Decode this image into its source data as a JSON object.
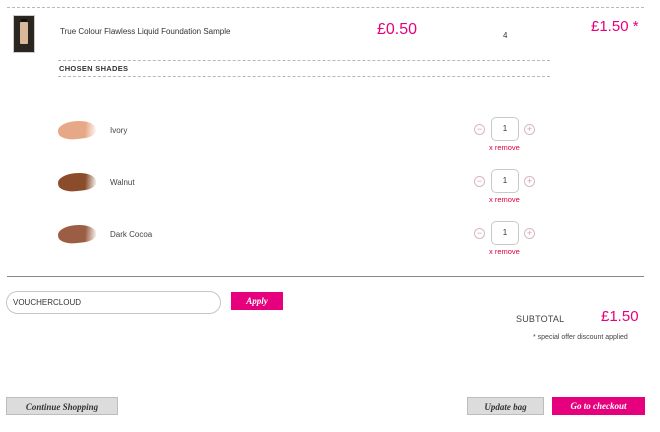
{
  "product": {
    "name": "True Colour Flawless Liquid Foundation Sample",
    "unit_price": "£0.50",
    "quantity": "4",
    "line_total": "£1.50 *"
  },
  "shades_heading": "CHOSEN SHADES",
  "shades": [
    {
      "name": "Ivory",
      "qty": "1",
      "remove_label": "x remove",
      "color": "#e7a887"
    },
    {
      "name": "Walnut",
      "qty": "1",
      "remove_label": "x remove",
      "color": "#8a4c2a"
    },
    {
      "name": "Dark Cocoa",
      "qty": "1",
      "remove_label": "x remove",
      "color": "#9b5e44"
    }
  ],
  "voucher": {
    "value": "VOUCHERCLOUD",
    "apply_label": "Apply"
  },
  "subtotal": {
    "label": "SUBTOTAL",
    "value": "£1.50",
    "note": "* special offer discount applied"
  },
  "buttons": {
    "continue": "Continue Shopping",
    "update": "Update bag",
    "checkout": "Go to checkout"
  },
  "colors": {
    "accent": "#e6007e",
    "remove": "#e0003a"
  }
}
